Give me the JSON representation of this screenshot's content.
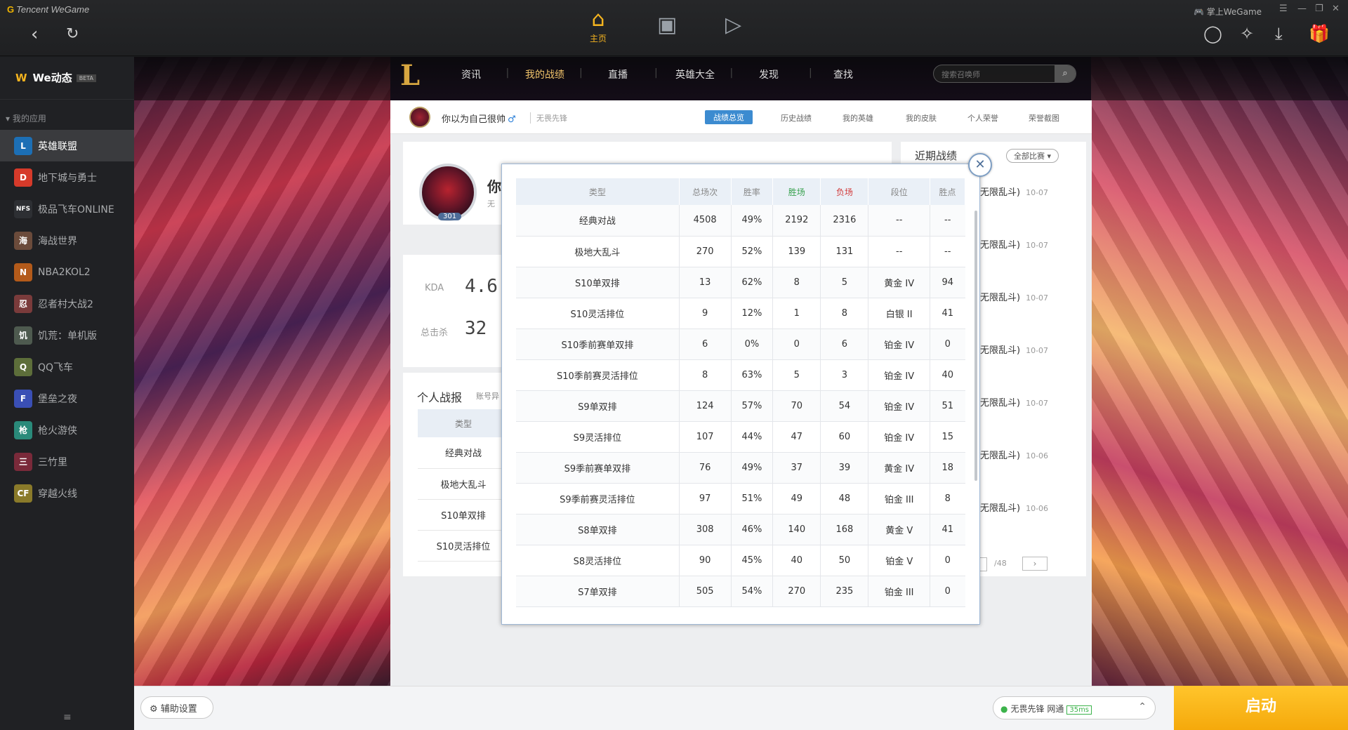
{
  "app": {
    "brand": "Tencent WeGame",
    "account": "掌上WeGame"
  },
  "topnav": {
    "home": "主页"
  },
  "sidebar": {
    "title": "We动态",
    "badge": "BETA",
    "section": "我的应用",
    "items": [
      {
        "label": "英雄联盟",
        "color": "#1c6fb5",
        "abbr": "L"
      },
      {
        "label": "地下城与勇士",
        "color": "#d63a2a",
        "abbr": "D"
      },
      {
        "label": "极品飞车ONLINE",
        "color": "#2d2f33",
        "abbr": "NFS"
      },
      {
        "label": "海战世界",
        "color": "#6b4b3b",
        "abbr": "海"
      },
      {
        "label": "NBA2KOL2",
        "color": "#b35a1a",
        "abbr": "N"
      },
      {
        "label": "忍者村大战2",
        "color": "#7a3b3b",
        "abbr": "忍"
      },
      {
        "label": "饥荒：单机版",
        "color": "#4e5a4f",
        "abbr": "饥"
      },
      {
        "label": "QQ飞车",
        "color": "#5d6e3a",
        "abbr": "Q"
      },
      {
        "label": "堡垒之夜",
        "color": "#3a4fb5",
        "abbr": "F"
      },
      {
        "label": "枪火游侠",
        "color": "#2a8a7a",
        "abbr": "枪"
      },
      {
        "label": "三竹里",
        "color": "#7a2a3a",
        "abbr": "三"
      },
      {
        "label": "穿越火线",
        "color": "#8a7a2a",
        "abbr": "CF"
      }
    ]
  },
  "lolnav": {
    "tabs": [
      "资讯",
      "我的战绩",
      "直播",
      "英雄大全",
      "发现",
      "查找"
    ],
    "search_placeholder": "搜索召唤师"
  },
  "profile": {
    "name": "你以为自己很帅",
    "gender_symbol": "♂",
    "region": "无畏先锋",
    "level": "301",
    "name_short": "你",
    "region_short": "无"
  },
  "subtabs": [
    "战绩总览",
    "历史战绩",
    "我的英雄",
    "我的皮肤",
    "个人荣誉",
    "荣誉截图"
  ],
  "stats": {
    "kda_label": "KDA",
    "kda_value": "4.6",
    "kills_label": "总击杀",
    "kills_value": "32"
  },
  "personal": {
    "title": "个人战报",
    "subtitle": "账号异",
    "col": "类型",
    "rows": [
      "经典对战",
      "极地大乱斗",
      "S10单双排",
      "S10灵活排位"
    ]
  },
  "recent": {
    "title": "近期战绩",
    "filter": "全部比赛 ▾",
    "items": [
      {
        "mode": "无限乱斗)",
        "date": "10-07"
      },
      {
        "mode": "无限乱斗)",
        "date": "10-07"
      },
      {
        "mode": "无限乱斗)",
        "date": "10-07"
      },
      {
        "mode": "无限乱斗)",
        "date": "10-07"
      },
      {
        "mode": "无限乱斗)",
        "date": "10-07"
      },
      {
        "mode": "无限乱斗)",
        "date": "10-06"
      },
      {
        "mode": "无限乱斗)",
        "date": "10-06"
      }
    ],
    "page_total": "/48"
  },
  "popup": {
    "headers": [
      "类型",
      "总场次",
      "胜率",
      "胜场",
      "负场",
      "段位",
      "胜点"
    ],
    "rows": [
      [
        "经典对战",
        "4508",
        "49%",
        "2192",
        "2316",
        "--",
        "--"
      ],
      [
        "极地大乱斗",
        "270",
        "52%",
        "139",
        "131",
        "--",
        "--"
      ],
      [
        "S10单双排",
        "13",
        "62%",
        "8",
        "5",
        "黄金 IV",
        "94"
      ],
      [
        "S10灵活排位",
        "9",
        "12%",
        "1",
        "8",
        "白银 II",
        "41"
      ],
      [
        "S10季前赛单双排",
        "6",
        "0%",
        "0",
        "6",
        "铂金 IV",
        "0"
      ],
      [
        "S10季前赛灵活排位",
        "8",
        "63%",
        "5",
        "3",
        "铂金 IV",
        "40"
      ],
      [
        "S9单双排",
        "124",
        "57%",
        "70",
        "54",
        "铂金 IV",
        "51"
      ],
      [
        "S9灵活排位",
        "107",
        "44%",
        "47",
        "60",
        "铂金 IV",
        "15"
      ],
      [
        "S9季前赛单双排",
        "76",
        "49%",
        "37",
        "39",
        "黄金 IV",
        "18"
      ],
      [
        "S9季前赛灵活排位",
        "97",
        "51%",
        "49",
        "48",
        "铂金 III",
        "8"
      ],
      [
        "S8单双排",
        "308",
        "46%",
        "140",
        "168",
        "黄金 V",
        "41"
      ],
      [
        "S8灵活排位",
        "90",
        "45%",
        "40",
        "50",
        "铂金 V",
        "0"
      ],
      [
        "S7单双排",
        "505",
        "54%",
        "270",
        "235",
        "铂金 III",
        "0"
      ]
    ]
  },
  "bottom": {
    "assist": "辅助设置",
    "server": "无畏先锋",
    "network": "网通",
    "ping": "35ms",
    "launch": "启动"
  }
}
